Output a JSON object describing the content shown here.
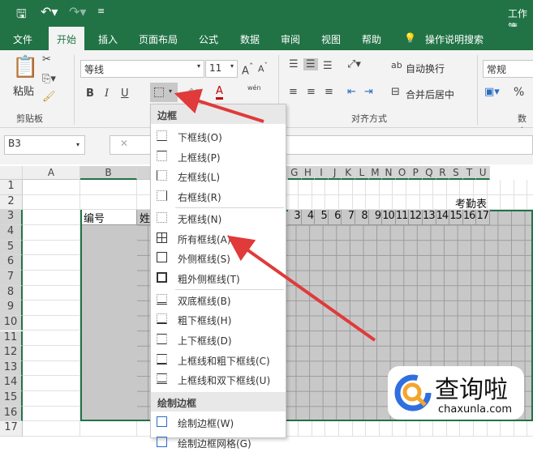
{
  "title_bar": {
    "title": "工作簿",
    "qat": [
      "save-icon",
      "undo-icon",
      "redo-icon",
      "customize-icon"
    ]
  },
  "tabs": [
    "文件",
    "开始",
    "插入",
    "页面布局",
    "公式",
    "数据",
    "审阅",
    "视图",
    "帮助",
    "操作说明搜索"
  ],
  "ribbon": {
    "clipboard": {
      "paste": "粘贴",
      "group": "剪贴板"
    },
    "font": {
      "name": "等线",
      "size": "11",
      "bold": "B",
      "italic": "I",
      "underline": "U",
      "font_color": "A",
      "phonetic": "wén"
    },
    "alignment": {
      "wrap": "自动换行",
      "merge": "合并后居中",
      "group": "对齐方式"
    },
    "number": {
      "format": "常规",
      "percent": "%",
      "group": "数字"
    }
  },
  "formula_bar": {
    "name_box": "B3",
    "cancel": "✕"
  },
  "sheet": {
    "columns_left": [
      "A",
      "B"
    ],
    "columns_right": [
      "G",
      "H",
      "I",
      "J",
      "K",
      "L",
      "M",
      "N",
      "O",
      "P",
      "Q",
      "R",
      "S",
      "T",
      "U"
    ],
    "rows": [
      "1",
      "2",
      "3",
      "4",
      "5",
      "6",
      "7",
      "8",
      "9",
      "10",
      "11",
      "12",
      "13",
      "14",
      "15",
      "16",
      "17"
    ],
    "title": "考勤表",
    "b3": "编号",
    "c3": "姓",
    "day_numbers": [
      "3",
      "4",
      "5",
      "6",
      "7",
      "8",
      "9",
      "10",
      "11",
      "12",
      "13",
      "14",
      "15",
      "16",
      "17"
    ]
  },
  "border_menu": {
    "header": "边框",
    "items": [
      "下框线(O)",
      "上框线(P)",
      "左框线(L)",
      "右框线(R)",
      "无框线(N)",
      "所有框线(A)",
      "外侧框线(S)",
      "粗外侧框线(T)",
      "双底框线(B)",
      "粗下框线(H)",
      "上下框线(D)",
      "上框线和粗下框线(C)",
      "上框线和双下框线(U)"
    ],
    "draw_header": "绘制边框",
    "draw_items": [
      "绘制边框(W)",
      "绘制边框网格(G)"
    ]
  },
  "watermark": {
    "brand": "查询啦",
    "url": "chaxunla.com"
  },
  "colors": {
    "excel_green": "#217346",
    "arrow": "#e03a3a",
    "selection": "#c8c8c8"
  }
}
